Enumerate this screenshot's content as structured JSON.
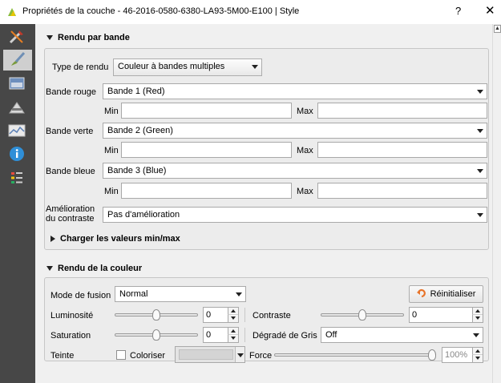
{
  "window": {
    "title": "Propriétés de la couche - 46-2016-0580-6380-LA93-5M00-E100 | Style",
    "help_glyph": "?",
    "close_glyph": "✕"
  },
  "sidebar": {
    "items": [
      {
        "icon": "general-tools-icon"
      },
      {
        "icon": "style-paintbrush-icon"
      },
      {
        "icon": "transparency-icon"
      },
      {
        "icon": "pyramids-icon"
      },
      {
        "icon": "histogram-icon"
      },
      {
        "icon": "metadata-info-icon"
      },
      {
        "icon": "legend-icon"
      }
    ]
  },
  "band_rendering": {
    "header": "Rendu par bande",
    "render_type_label": "Type de rendu",
    "render_type_value": "Couleur à bandes multiples",
    "red_label": "Bande rouge",
    "red_value": "Bande 1 (Red)",
    "green_label": "Bande verte",
    "green_value": "Bande 2 (Green)",
    "blue_label": "Bande bleue",
    "blue_value": "Bande 3 (Blue)",
    "min_label": "Min",
    "max_label": "Max",
    "red_min": "",
    "red_max": "",
    "green_min": "",
    "green_max": "",
    "blue_min": "",
    "blue_max": "",
    "contrast_label_line1": "Amélioration",
    "contrast_label_line2": "du contraste",
    "contrast_value": "Pas d'amélioration",
    "load_minmax": "Charger les valeurs min/max"
  },
  "color_rendering": {
    "header": "Rendu de la couleur",
    "blend_label": "Mode de fusion",
    "blend_value": "Normal",
    "reset_label": "Réinitialiser",
    "brightness_label": "Luminosité",
    "brightness_value": "0",
    "brightness_level": 0.5,
    "contrast_label": "Contraste",
    "contrast_value": "0",
    "contrast_level": 0.5,
    "saturation_label": "Saturation",
    "saturation_value": "0",
    "saturation_level": 0.5,
    "grayscale_label": "Dégradé de Gris",
    "grayscale_value": "Off",
    "hue_label": "Teinte",
    "colorize_label": "Coloriser",
    "force_label": "Force",
    "force_value": "100%",
    "force_level": 1.0
  },
  "colors": {
    "sidebar_bg": "#474747",
    "window_bg": "#f0f0f0",
    "reset_icon": "#e8742a"
  }
}
